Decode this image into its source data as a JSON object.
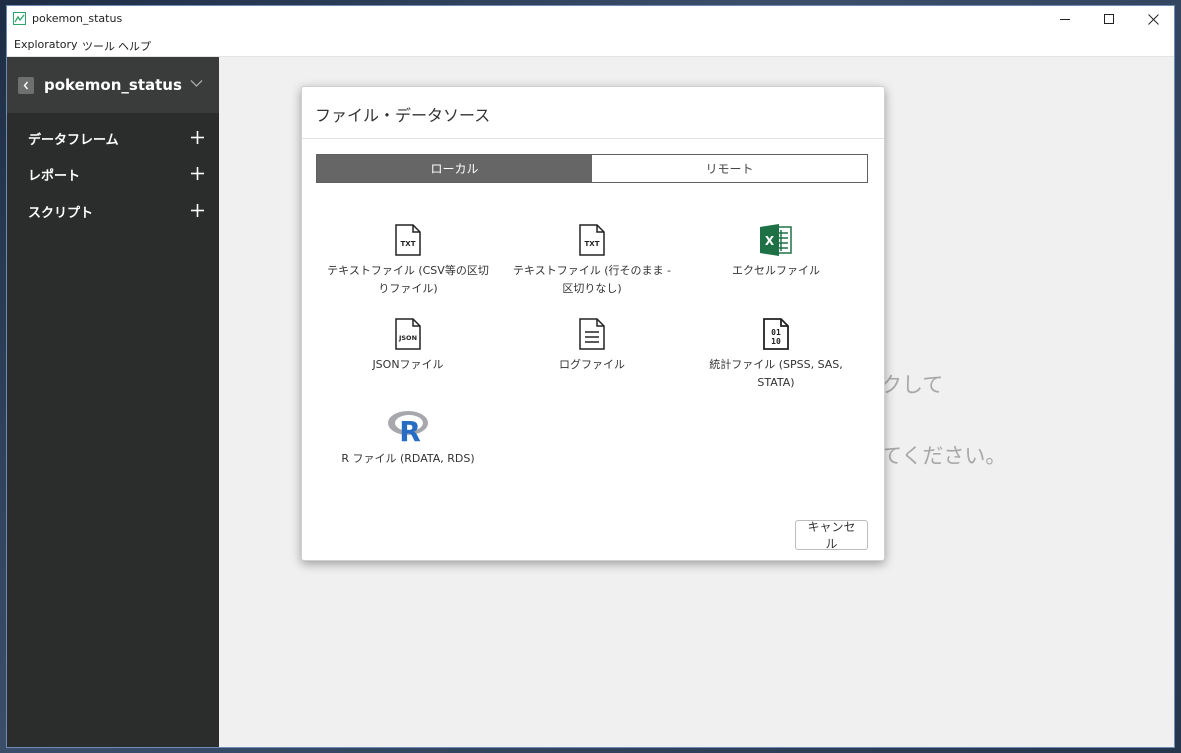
{
  "window": {
    "title": "pokemon_status"
  },
  "menu": [
    "Exploratory",
    "ツール",
    "ヘルプ"
  ],
  "sidebar": {
    "project_name": "pokemon_status",
    "items": [
      {
        "label": "データフレーム"
      },
      {
        "label": "レポート"
      },
      {
        "label": "スクリプト"
      }
    ]
  },
  "main": {
    "hint_line1": "クして",
    "hint_line2": "てください。"
  },
  "dialog": {
    "title": "ファイル・データソース",
    "tabs": [
      {
        "label": "ローカル",
        "active": true
      },
      {
        "label": "リモート",
        "active": false
      }
    ],
    "sources": [
      {
        "label": "テキストファイル (CSV等の区切りファイル)",
        "icon": "txt-file-icon"
      },
      {
        "label": "テキストファイル (行そのまま - 区切りなし)",
        "icon": "txt-file-icon"
      },
      {
        "label": "エクセルファイル",
        "icon": "excel-icon"
      },
      {
        "label": "JSONファイル",
        "icon": "json-file-icon"
      },
      {
        "label": "ログファイル",
        "icon": "log-file-icon"
      },
      {
        "label": "統計ファイル (SPSS, SAS, STATA)",
        "icon": "binary-file-icon"
      },
      {
        "label": "R ファイル (RDATA, RDS)",
        "icon": "r-logo-icon"
      }
    ],
    "cancel_label": "キャンセル"
  },
  "colors": {
    "sidebar_bg": "#2b2d2c",
    "active_tab": "#666666",
    "excel_green": "#1e7145",
    "r_blue": "#276dc3"
  }
}
